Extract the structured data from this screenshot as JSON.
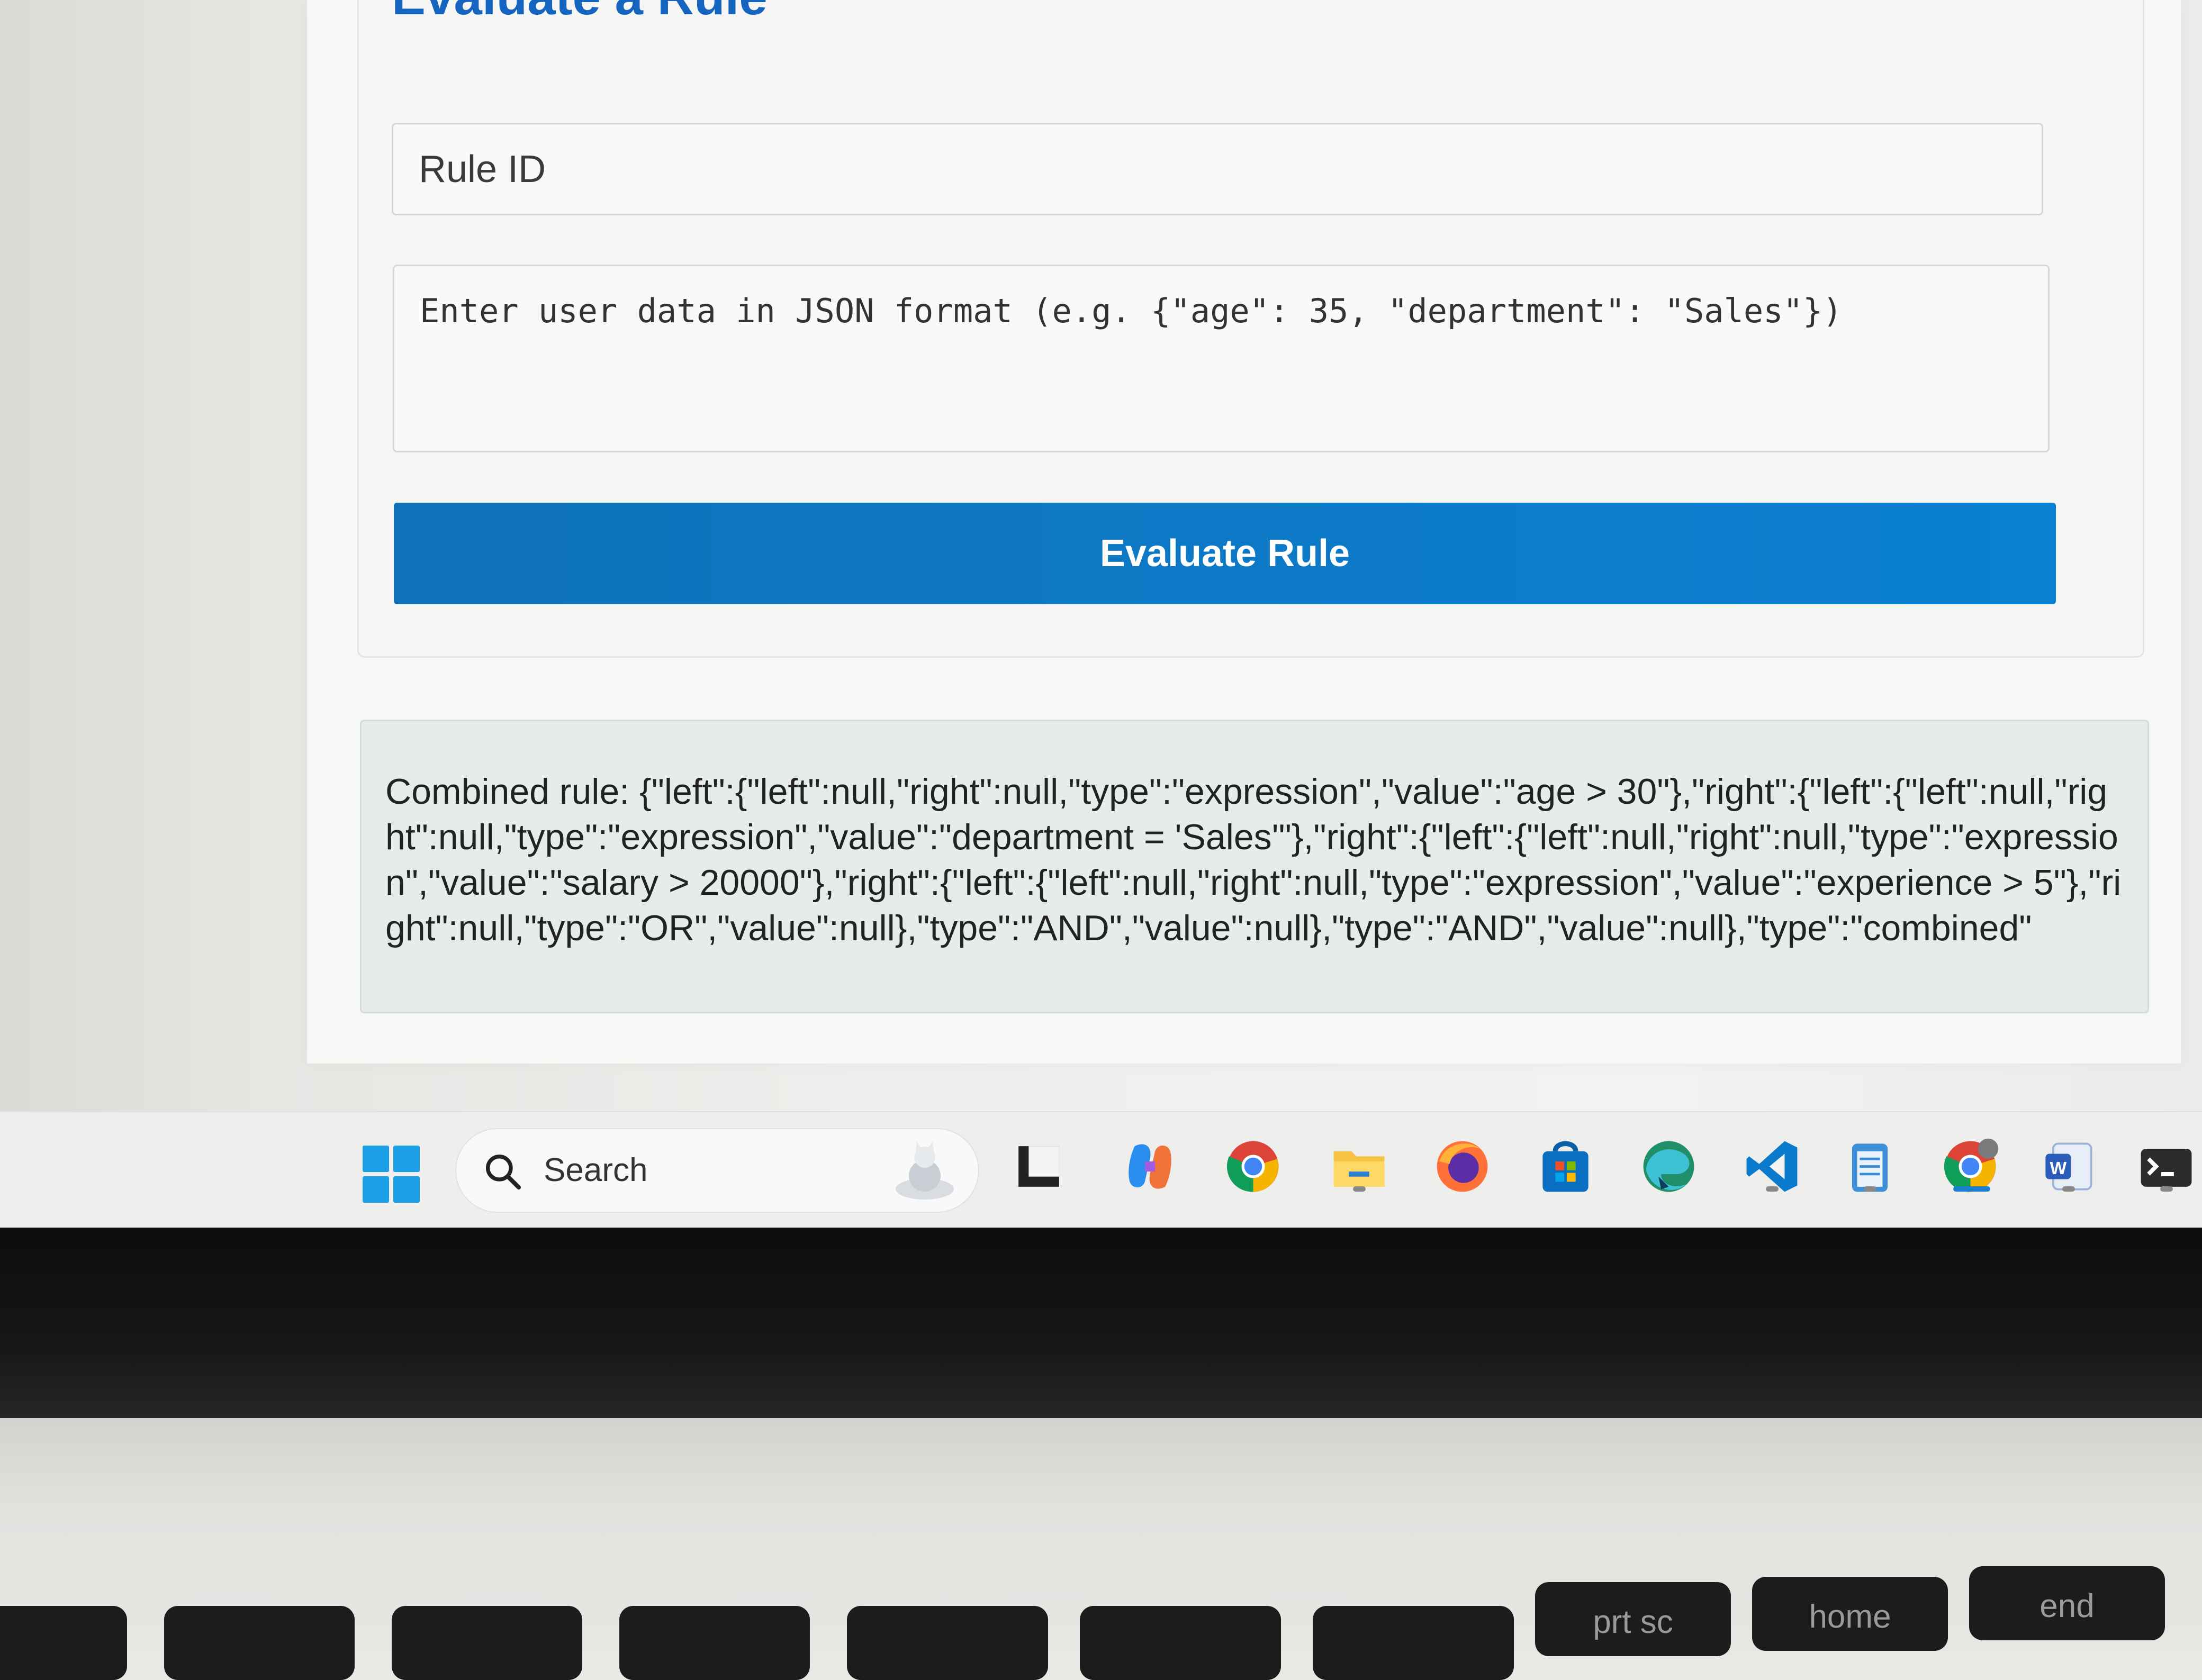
{
  "page": {
    "title": "Evaluate a Rule"
  },
  "form": {
    "rule_id_placeholder": "Rule ID",
    "user_data_placeholder": "Enter user data in JSON format (e.g. {\"age\": 35, \"department\": \"Sales\"})",
    "evaluate_button_label": "Evaluate Rule"
  },
  "result": {
    "text": "Combined rule: {\"left\":{\"left\":null,\"right\":null,\"type\":\"expression\",\"value\":\"age > 30\"},\"right\":{\"left\":{\"left\":null,\"right\":null,\"type\":\"expression\",\"value\":\"department = 'Sales'\"},\"right\":{\"left\":{\"left\":null,\"right\":null,\"type\":\"expression\",\"value\":\"salary > 20000\"},\"right\":{\"left\":{\"left\":null,\"right\":null,\"type\":\"expression\",\"value\":\"experience > 5\"},\"right\":null,\"type\":\"OR\",\"value\":null},\"type\":\"AND\",\"value\":null},\"type\":\"AND\",\"value\":null},\"type\":\"combined\""
  },
  "taskbar": {
    "search_label": "Search",
    "icons": [
      "task-view-icon",
      "copilot-icon",
      "chrome-icon",
      "file-explorer-icon",
      "firefox-icon",
      "microsoft-store-icon",
      "edge-dev-icon",
      "vscode-icon",
      "notepad-icon",
      "chrome-profile-icon",
      "word-icon",
      "terminal-icon"
    ]
  },
  "keyboard": {
    "keys": [
      "prt sc",
      "home",
      "end"
    ]
  },
  "colors": {
    "accent": "#1565c0",
    "button": "#0d79c6",
    "result_bg": "#e6ebec"
  }
}
